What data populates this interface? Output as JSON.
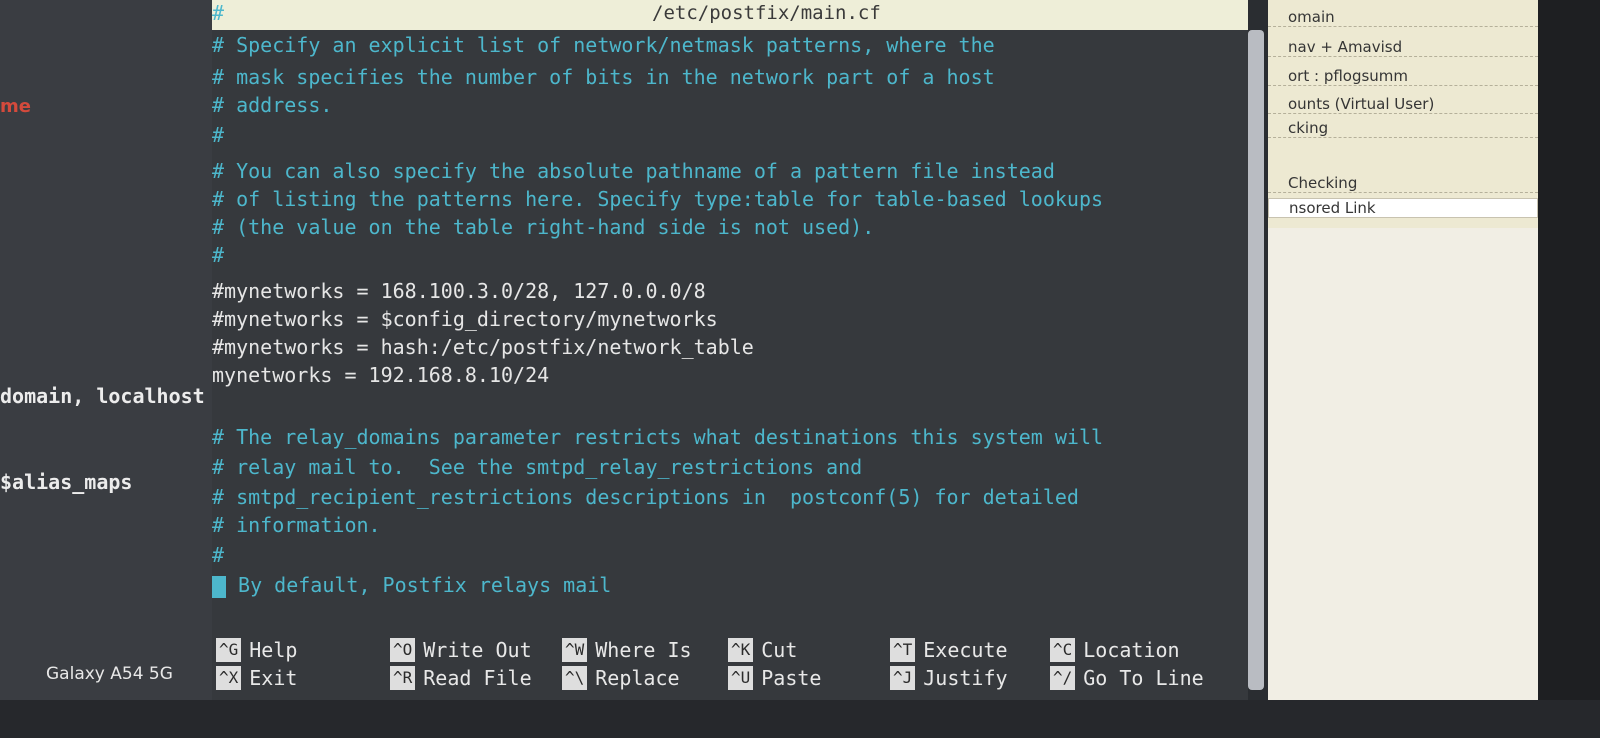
{
  "window": {
    "title_path": "/etc/postfix/main.cf"
  },
  "left_bg": {
    "fragments": [
      "me",
      "domain, localhost",
      "$alias_maps"
    ],
    "device_watermark": "Galaxy A54 5G"
  },
  "right_bg": {
    "items": [
      "omain",
      "nav + Amavisd",
      "ort : pflogsumm",
      "ounts (Virtual User)",
      "cking",
      "Checking",
      "nsored Link"
    ]
  },
  "editor": {
    "lines": [
      {
        "text": "#",
        "style": "comment"
      },
      {
        "text": "# Specify an explicit list of network/netmask patterns, where the",
        "style": "comment"
      },
      {
        "text": "# mask specifies the number of bits in the network part of a host",
        "style": "comment"
      },
      {
        "text": "# address.",
        "style": "comment"
      },
      {
        "text": "#",
        "style": "comment"
      },
      {
        "text": "# You can also specify the absolute pathname of a pattern file instead",
        "style": "comment"
      },
      {
        "text": "# of listing the patterns here. Specify type:table for table-based lookups",
        "style": "comment"
      },
      {
        "text": "# (the value on the table right-hand side is not used).",
        "style": "comment"
      },
      {
        "text": "#",
        "style": "comment"
      },
      {
        "text": "#mynetworks = 168.100.3.0/28, 127.0.0.0/8",
        "style": "code"
      },
      {
        "text": "#mynetworks = $config_directory/mynetworks",
        "style": "code"
      },
      {
        "text": "#mynetworks = hash:/etc/postfix/network_table",
        "style": "code"
      },
      {
        "text": "mynetworks = 192.168.8.10/24",
        "style": "code"
      },
      {
        "text": "",
        "style": "code"
      },
      {
        "text": "# The relay_domains parameter restricts what destinations this system will",
        "style": "comment"
      },
      {
        "text": "# relay mail to.  See the smtpd_relay_restrictions and",
        "style": "comment"
      },
      {
        "text": "# smtpd_recipient_restrictions descriptions in  postconf(5) for detailed",
        "style": "comment"
      },
      {
        "text": "# information.",
        "style": "comment"
      },
      {
        "text": "#",
        "style": "comment"
      },
      {
        "text": " By default, Postfix relays mail",
        "style": "comment"
      }
    ]
  },
  "shortcuts": [
    {
      "key": "^G",
      "label": "Help"
    },
    {
      "key": "^X",
      "label": "Exit"
    },
    {
      "key": "^O",
      "label": "Write Out"
    },
    {
      "key": "^R",
      "label": "Read File"
    },
    {
      "key": "^W",
      "label": "Where Is"
    },
    {
      "key": "^\\",
      "label": "Replace"
    },
    {
      "key": "^K",
      "label": "Cut"
    },
    {
      "key": "^U",
      "label": "Paste"
    },
    {
      "key": "^T",
      "label": "Execute"
    },
    {
      "key": "^J",
      "label": "Justify"
    },
    {
      "key": "^C",
      "label": "Location"
    },
    {
      "key": "^/",
      "label": "Go To Line"
    }
  ]
}
